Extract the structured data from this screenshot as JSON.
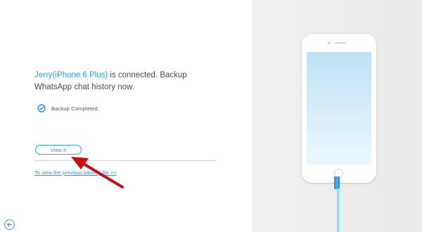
{
  "status": {
    "device_name": "Jerry(iPhone 6 Plus)",
    "message": " is connected. Backup WhatsApp chat history now."
  },
  "backup": {
    "status_text": "Backup Completed.",
    "icon": "check-circle-icon"
  },
  "actions": {
    "view_label": "View It",
    "previous_link": "To view the previous backup file >>"
  },
  "navigation": {
    "back_icon": "back-arrow-icon"
  },
  "visual": {
    "phone_icon": "iphone-illustration",
    "cable_icon": "usb-cable",
    "annotation_arrow": "red-arrow"
  },
  "colors": {
    "accent_blue": "#2fa0e6",
    "annotation_red": "#c80f16"
  }
}
